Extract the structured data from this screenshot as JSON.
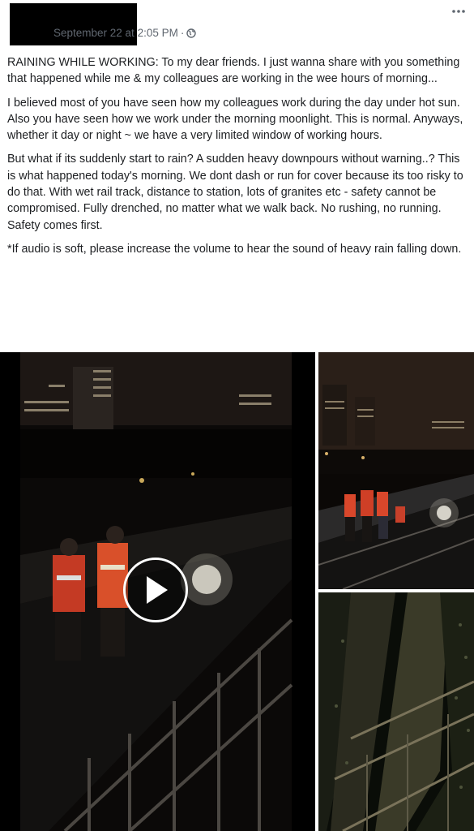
{
  "post": {
    "author_redacted": true,
    "timestamp": "September 22 at 2:05 PM",
    "separator": "·",
    "privacy_icon": "globe-icon",
    "more_icon": "more-options-icon",
    "paragraphs": [
      "RAINING WHILE WORKING: To my dear friends. I just wanna share with you something that happened while me & my colleagues are working in the wee hours of morning...",
      "I believed most of you have seen how my colleagues work during the day under hot sun. Also you have seen how we work under the morning moonlight. This is normal. Anyways, whether it day or night ~ we have a very limited window of working hours.",
      "But what if its suddenly start to rain? A sudden heavy downpours without warning..? This is what happened today's morning. We dont dash or run for cover because its too risky to do that. With wet rail track, distance to station, lots of granites etc - safety cannot be compromised. Fully drenched, no matter what we walk back. No rushing, no running. Safety comes first.",
      "*If audio is soft, please increase the volume to hear the sound of heavy rain falling down."
    ]
  },
  "media": {
    "video_icon": "play-icon",
    "photos": [
      "night-rail-track-photo",
      "rail-closeup-photo"
    ]
  },
  "colors": {
    "meta_text": "#606770",
    "body_text": "#1c1e21",
    "safety_vest": "#d9472b"
  }
}
